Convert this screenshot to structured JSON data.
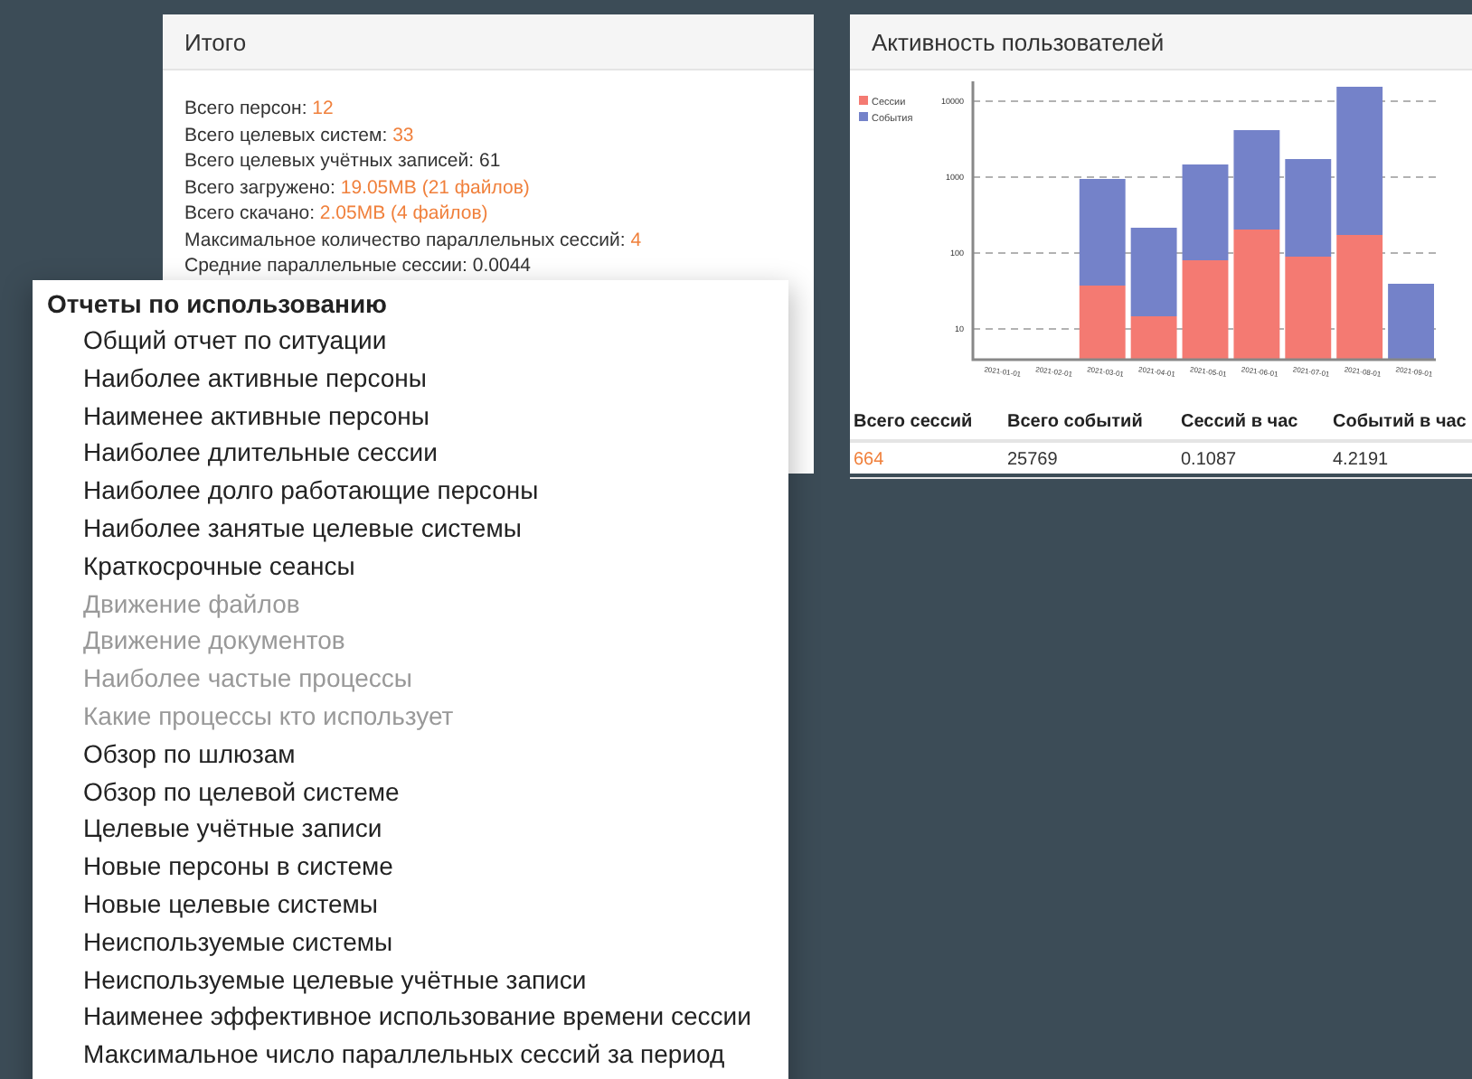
{
  "summary": {
    "title": "Итого",
    "stats": [
      {
        "label": "Всего персон:",
        "value": "12",
        "highlight": true
      },
      {
        "label": "Всего целевых систем:",
        "value": "33",
        "highlight": true
      },
      {
        "label": "Всего целевых учётных записей:",
        "value": "61",
        "highlight": false
      },
      {
        "label": "Всего загружено:",
        "value": "19.05MB (21 файлов)",
        "highlight": true
      },
      {
        "label": "Всего скачано:",
        "value": "2.05MB (4 файлов)",
        "highlight": true
      },
      {
        "label": "Максимальное количество параллельных сессий:",
        "value": "4",
        "highlight": true
      },
      {
        "label": "Средние параллельные сессии:",
        "value": "0.0044",
        "highlight": false
      }
    ]
  },
  "activity": {
    "title": "Активность пользователей",
    "chart": {
      "legend": [
        {
          "name": "Сессии",
          "color": "#f47a72"
        },
        {
          "name": "События",
          "color": "#7482c9"
        }
      ],
      "y_labels": [
        "10000",
        "1000",
        "100",
        "10"
      ],
      "x_labels": [
        "2021-01-01",
        "2021-02-01",
        "2021-03-01",
        "2021-04-01",
        "2021-05-01",
        "2021-06-01",
        "2021-07-01",
        "2021-08-01",
        "2021-09-01"
      ]
    },
    "table": {
      "columns": [
        "Всего сессий",
        "Всего событий",
        "Сессий в час",
        "Событий в час"
      ],
      "rows": [
        [
          {
            "text": "664",
            "highlight": true
          },
          {
            "text": "25769",
            "highlight": false
          },
          {
            "text": "0.1087",
            "highlight": false
          },
          {
            "text": "4.2191",
            "highlight": false
          }
        ]
      ]
    }
  },
  "menu": {
    "title": "Отчеты по использованию",
    "items": [
      {
        "label": "Общий отчет по ситуации",
        "disabled": false
      },
      {
        "label": "Наиболее активные персоны",
        "disabled": false
      },
      {
        "label": "Наименее активные персоны",
        "disabled": false
      },
      {
        "label": "Наиболее длительные сессии",
        "disabled": false
      },
      {
        "label": "Наиболее долго работающие персоны",
        "disabled": false
      },
      {
        "label": "Наиболее занятые целевые системы",
        "disabled": false
      },
      {
        "label": "Краткосрочные сеансы",
        "disabled": false
      },
      {
        "label": "Движение файлов",
        "disabled": true
      },
      {
        "label": "Движение документов",
        "disabled": true
      },
      {
        "label": "Наиболее частые процессы",
        "disabled": true
      },
      {
        "label": "Какие процессы кто использует",
        "disabled": true
      },
      {
        "label": "Обзор по шлюзам",
        "disabled": false
      },
      {
        "label": "Обзор по целевой системе",
        "disabled": false
      },
      {
        "label": "Целевые учётные записи",
        "disabled": false
      },
      {
        "label": "Новые персоны в системе",
        "disabled": false
      },
      {
        "label": "Новые целевые системы",
        "disabled": false
      },
      {
        "label": "Неиспользуемые системы",
        "disabled": false
      },
      {
        "label": "Неиспользуемые целевые учётные записи",
        "disabled": false
      },
      {
        "label": "Наименее эффективное использование времени сессии",
        "disabled": false
      },
      {
        "label": "Максимальное число параллельных сессий за период",
        "disabled": false
      }
    ]
  }
}
